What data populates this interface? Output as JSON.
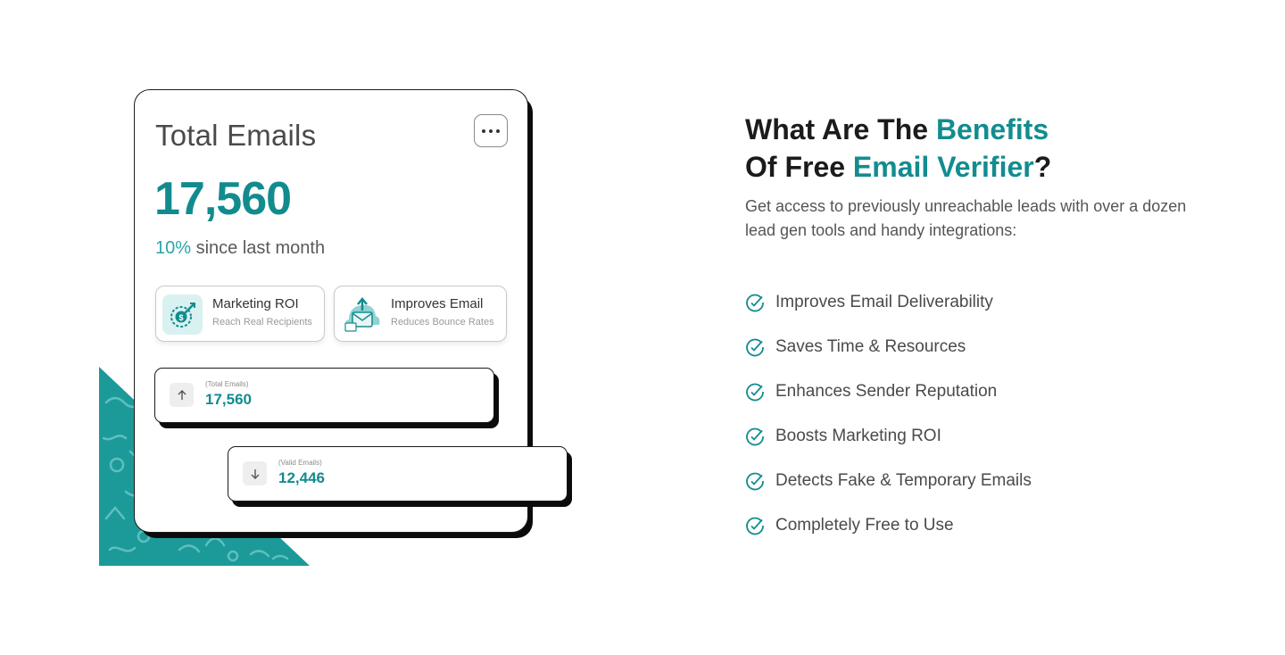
{
  "card": {
    "title": "Total Emails",
    "total": "17,560",
    "change_pct": "10%",
    "change_text": "since last month",
    "features": [
      {
        "title": "Marketing ROI",
        "subtitle": "Reach Real Recipients",
        "icon": "target-dollar-icon"
      },
      {
        "title": "Improves Email",
        "subtitle": "Reduces Bounce Rates",
        "icon": "email-upload-icon"
      }
    ],
    "stats": [
      {
        "label": "(Total Emails)",
        "value": "17,560",
        "icon": "arrow-up-icon"
      },
      {
        "label": "(Valid Emails)",
        "value": "12,446",
        "icon": "arrow-down-icon"
      }
    ]
  },
  "heading": {
    "part1": "What Are The ",
    "highlight1": "Benefits",
    "part2": "Of Free ",
    "highlight2": "Email Verifier",
    "part3": "?"
  },
  "subtext": "Get access to previously unreachable leads with over a dozen lead gen tools and handy integrations:",
  "benefits": [
    "Improves Email Deliverability",
    "Saves Time & Resources",
    "Enhances Sender Reputation",
    "Boosts Marketing ROI",
    "Detects Fake & Temporary Emails",
    "Completely Free to Use"
  ],
  "colors": {
    "accent": "#138c8f",
    "accent_light": "#2aa4a8",
    "pattern_bg": "#1c9a9a",
    "text_dark": "#1b1b1b",
    "text_body": "#4a4a4a"
  }
}
